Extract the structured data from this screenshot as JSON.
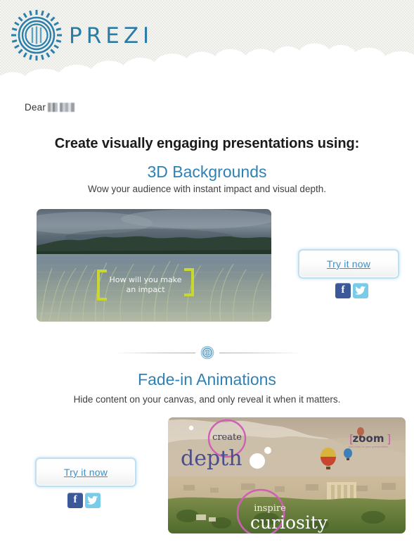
{
  "brand": {
    "name": "PREZI",
    "logo_icon": "prezi-circular-logo-icon",
    "accent_blue": "#2a7ba6",
    "link_blue": "#3f8fc4",
    "heading_blue": "#2f81b4",
    "header_bg": "#e9eae4"
  },
  "greeting": {
    "salutation": "Dear",
    "recipient_redacted": true
  },
  "headline": {
    "main": "Create visually engaging presentations using:"
  },
  "sections": [
    {
      "title": "3D Backgrounds",
      "description": "Wow your audience with instant impact and visual depth.",
      "cta_label": "Try it now",
      "image": {
        "alt": "Lake and forest with stormy sky, grass overlay",
        "overlay_text_line1": "How will you make",
        "overlay_text_line2": "an impact",
        "bracket_color": "#c8d82f"
      },
      "social": [
        {
          "label": "f",
          "name": "facebook-icon",
          "color": "#3b5998"
        },
        {
          "label": "t",
          "name": "twitter-icon",
          "color": "#78cce8"
        }
      ]
    },
    {
      "title": "Fade-in Animations",
      "description": "Hide content on your canvas, and only reveal it when it matters.",
      "cta_label": "Try it now",
      "image": {
        "alt": "Hot air balloons over desert valley at sunrise",
        "word_create": "create",
        "word_depth": "depth",
        "word_zoom": "zoom",
        "word_inspire": "inspire",
        "word_curiosity": "curiosity",
        "circle_color": "#cf5fb5",
        "depth_color": "#4a4f8a"
      },
      "social": [
        {
          "label": "f",
          "name": "facebook-icon",
          "color": "#3b5998"
        },
        {
          "label": "t",
          "name": "twitter-icon",
          "color": "#78cce8"
        }
      ]
    }
  ],
  "divider": {
    "icon": "prezi-mark-icon"
  }
}
